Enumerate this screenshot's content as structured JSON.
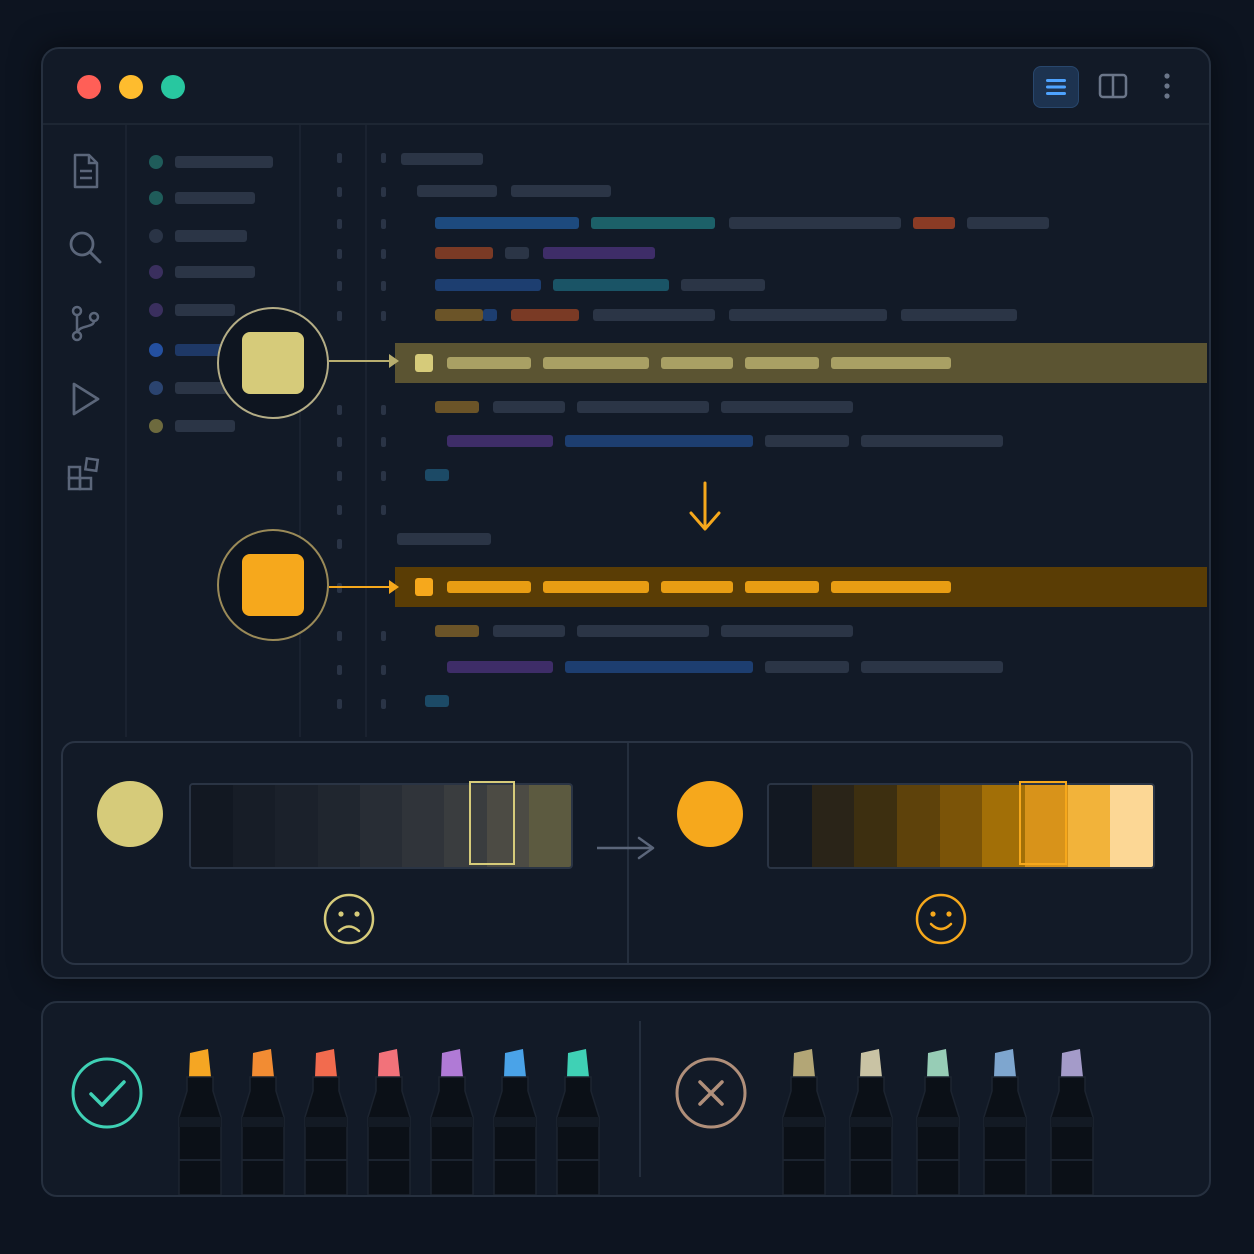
{
  "window": {
    "traffic_lights": [
      "#ff5f57",
      "#febc2e",
      "#28c7a0"
    ],
    "toolbar_icons": [
      "list-icon",
      "split-view-icon",
      "more-vertical-icon"
    ],
    "activity_icons": [
      "file-icon",
      "search-icon",
      "source-control-icon",
      "run-icon",
      "extensions-icon"
    ]
  },
  "highlight": {
    "before_color": "#d6cb7a",
    "after_color": "#f6a81c",
    "before_row_bg": "#5b5432",
    "after_row_bg": "#5a3d05",
    "arrow_color": "#f6a81c"
  },
  "palette": {
    "before": {
      "swatch": "#d6cb7a",
      "ramp": [
        "#121822",
        "#171d27",
        "#1b212b",
        "#20262f",
        "#282d35",
        "#30343a",
        "#3a3d3f",
        "#4c4b44",
        "#5c5a40"
      ],
      "selected_index": 7,
      "face": "sad-face-icon"
    },
    "after": {
      "swatch": "#f6a81c",
      "ramp": [
        "#121822",
        "#2a2418",
        "#3d2f10",
        "#5e420b",
        "#7b5408",
        "#a26f07",
        "#d8931a",
        "#f2b33a",
        "#fcd795"
      ],
      "selected_index": 5,
      "face": "happy-face-icon"
    }
  },
  "markers": {
    "good": {
      "status_icon": "check-icon",
      "tips": [
        "#f5a623",
        "#f28c33",
        "#f26b4e",
        "#f2727a",
        "#b07ad6",
        "#4aa3e8",
        "#3fd1b5"
      ]
    },
    "bad": {
      "status_icon": "x-icon",
      "tips": [
        "#b3a676",
        "#c9c3a4",
        "#97cdb6",
        "#7ea6cf",
        "#a49bc9"
      ]
    }
  }
}
